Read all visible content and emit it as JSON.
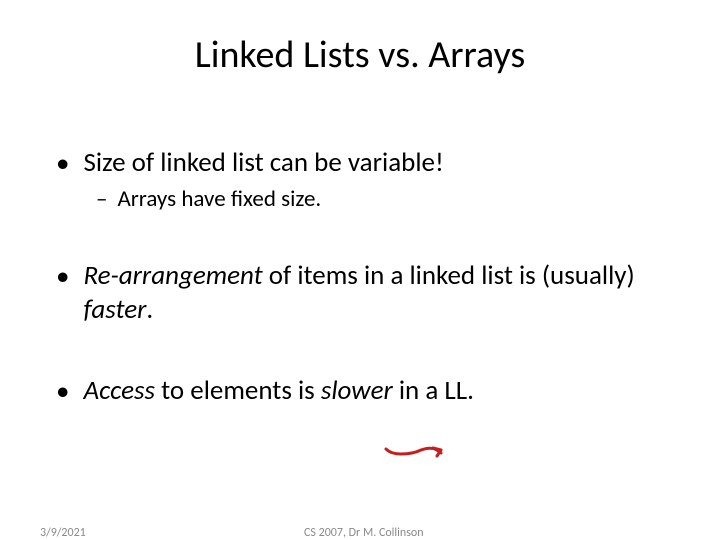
{
  "title": "Linked Lists vs. Arrays",
  "bullet1": {
    "text": "Size of linked list can be variable!"
  },
  "sub1": {
    "text": "Arrays have fixed size."
  },
  "bullet2": {
    "pre": "",
    "italic1": "Re-arrangement",
    "mid": " of items in a linked list is (usually) ",
    "italic2": "faster",
    "post": "."
  },
  "bullet3": {
    "italic1": "Access",
    "mid": " to elements is ",
    "italic2": "slower",
    "post": " in a LL."
  },
  "footer": {
    "date": "3/9/2021",
    "course": "CS 2007,  Dr M. Collinson"
  }
}
